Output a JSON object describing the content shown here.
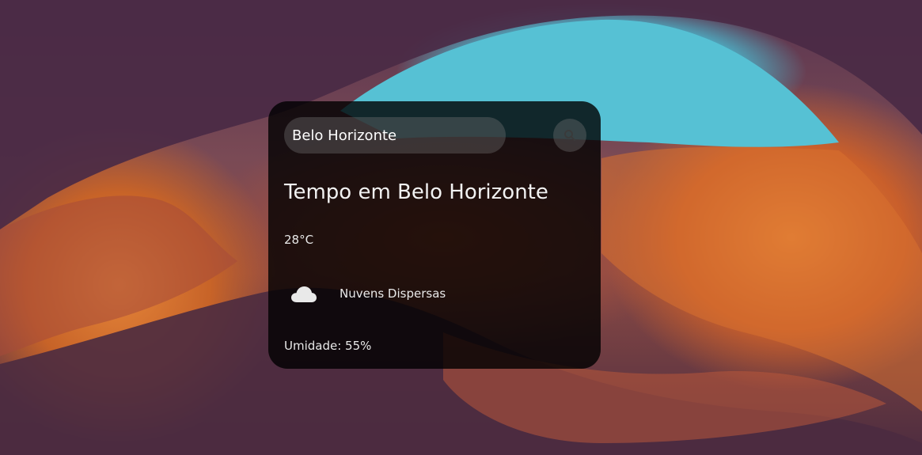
{
  "search": {
    "value": "Belo Horizonte",
    "button_icon": "search-icon"
  },
  "weather": {
    "title": "Tempo em Belo Horizonte",
    "temperature": "28°C",
    "condition_icon": "cloud-icon",
    "description": "Nuvens Dispersas",
    "humidity": "Umidade: 55%"
  },
  "colors": {
    "card_background": "#000000",
    "text": "#ffffff",
    "sky": "#4bb9cf",
    "canyon_orange": "#e58539",
    "canyon_purple": "#5a3550"
  }
}
